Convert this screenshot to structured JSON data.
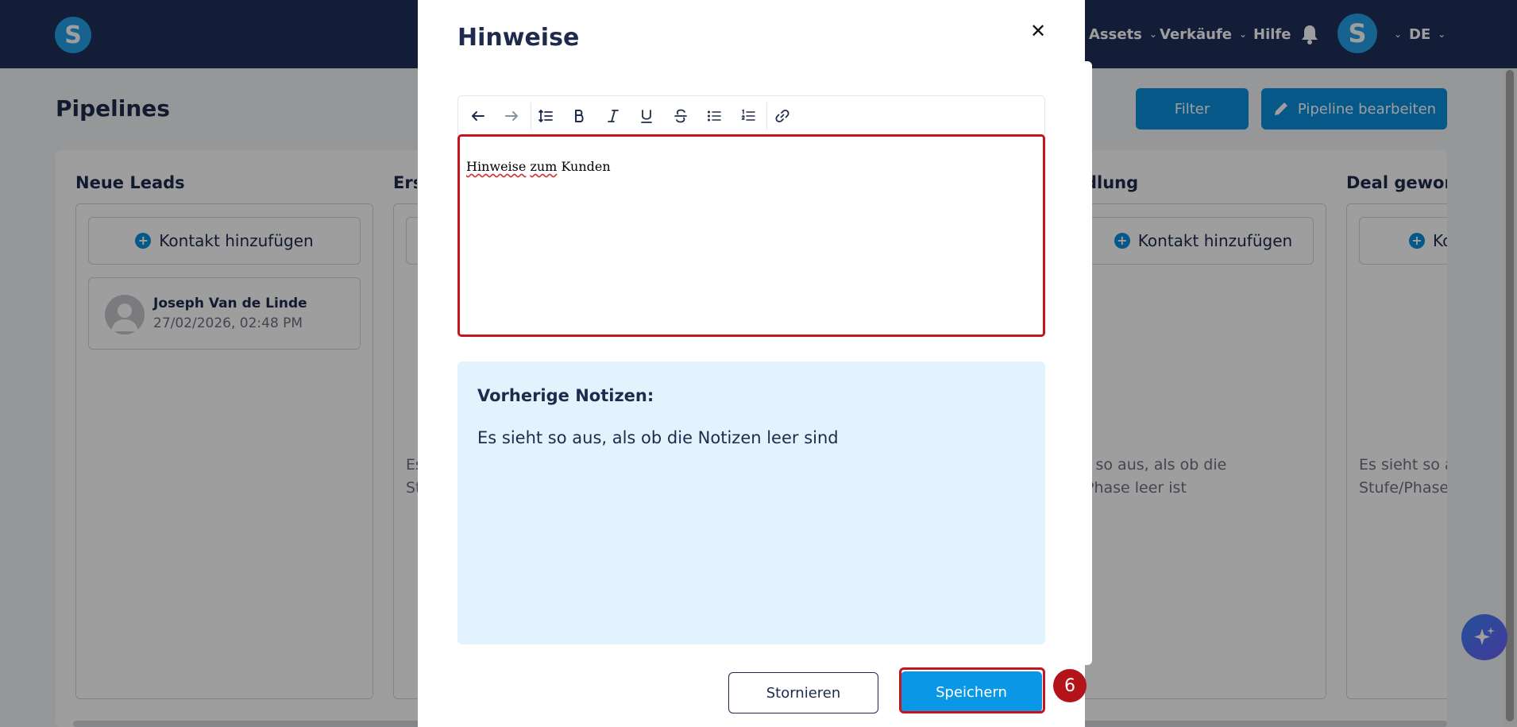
{
  "topbar": {
    "logo_letter": "S",
    "nav_items": [
      "Assets",
      "Verkäufe",
      "Hilfe"
    ],
    "user_initial": "S",
    "language": "DE",
    "brand_color": "#1f2f5b",
    "accent_color": "#0a8fdc"
  },
  "page": {
    "title": "Pipelines",
    "filter_label": "Filter",
    "edit_label": "Pipeline bearbeiten"
  },
  "columns": [
    {
      "title": "Neue Leads",
      "add_label": "Kontakt hinzufügen"
    },
    {
      "title": "Ers",
      "add_label": "",
      "empty_line1": "Es",
      "empty_line2": "St"
    },
    {
      "title": "dlung",
      "add_label": "Kontakt hinzufügen",
      "empty_line1": "t so aus, als ob die",
      "empty_line2": "Phase leer ist"
    },
    {
      "title": "Deal gewon",
      "add_label": "Ko",
      "empty_line1": "Es sieht so a",
      "empty_line2": "Stufe/Phase"
    }
  ],
  "lead": {
    "name": "Joseph Van de Linde",
    "date": "27/02/2026, 02:48 PM"
  },
  "modal": {
    "title": "Hinweise",
    "close_symbol": "✕",
    "editor_word1": "Hinweise",
    "editor_word2": "zum",
    "editor_word3": "Kunden",
    "previous_notes_title": "Vorherige Notizen:",
    "previous_notes_text": "Es sieht so aus, als ob die Notizen leer sind",
    "cancel_label": "Stornieren",
    "save_label": "Speichern",
    "toolbar_icons": [
      "undo-icon",
      "redo-icon",
      "line-height-icon",
      "bold-icon",
      "italic-icon",
      "underline-icon",
      "strikethrough-icon",
      "bullet-list-icon",
      "numbered-list-icon",
      "link-icon"
    ]
  },
  "annotation": {
    "step_number": "6",
    "highlight_color": "#c4161c"
  }
}
